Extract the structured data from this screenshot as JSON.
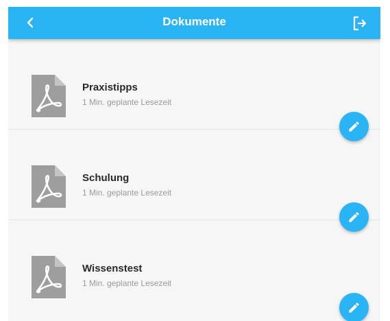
{
  "header": {
    "title": "Dokumente",
    "back_icon": "chevron-left-icon",
    "logout_icon": "logout-icon"
  },
  "documents": [
    {
      "title": "Praxistipps",
      "subtitle": "1 Min. geplante Lesezeit",
      "icon": "pdf-document-icon",
      "action_icon": "pencil-icon"
    },
    {
      "title": "Schulung",
      "subtitle": "1 Min. geplante Lesezeit",
      "icon": "pdf-document-icon",
      "action_icon": "pencil-icon"
    },
    {
      "title": "Wissenstest",
      "subtitle": "1 Min. geplante Lesezeit",
      "icon": "pdf-document-icon",
      "action_icon": "pencil-icon"
    }
  ],
  "colors": {
    "accent": "#2ab3f5",
    "background": "#f6f6f6",
    "icon_gray": "#9e9e9e",
    "title_text": "#2a2a2a",
    "subtitle_text": "#9a9a9a"
  }
}
